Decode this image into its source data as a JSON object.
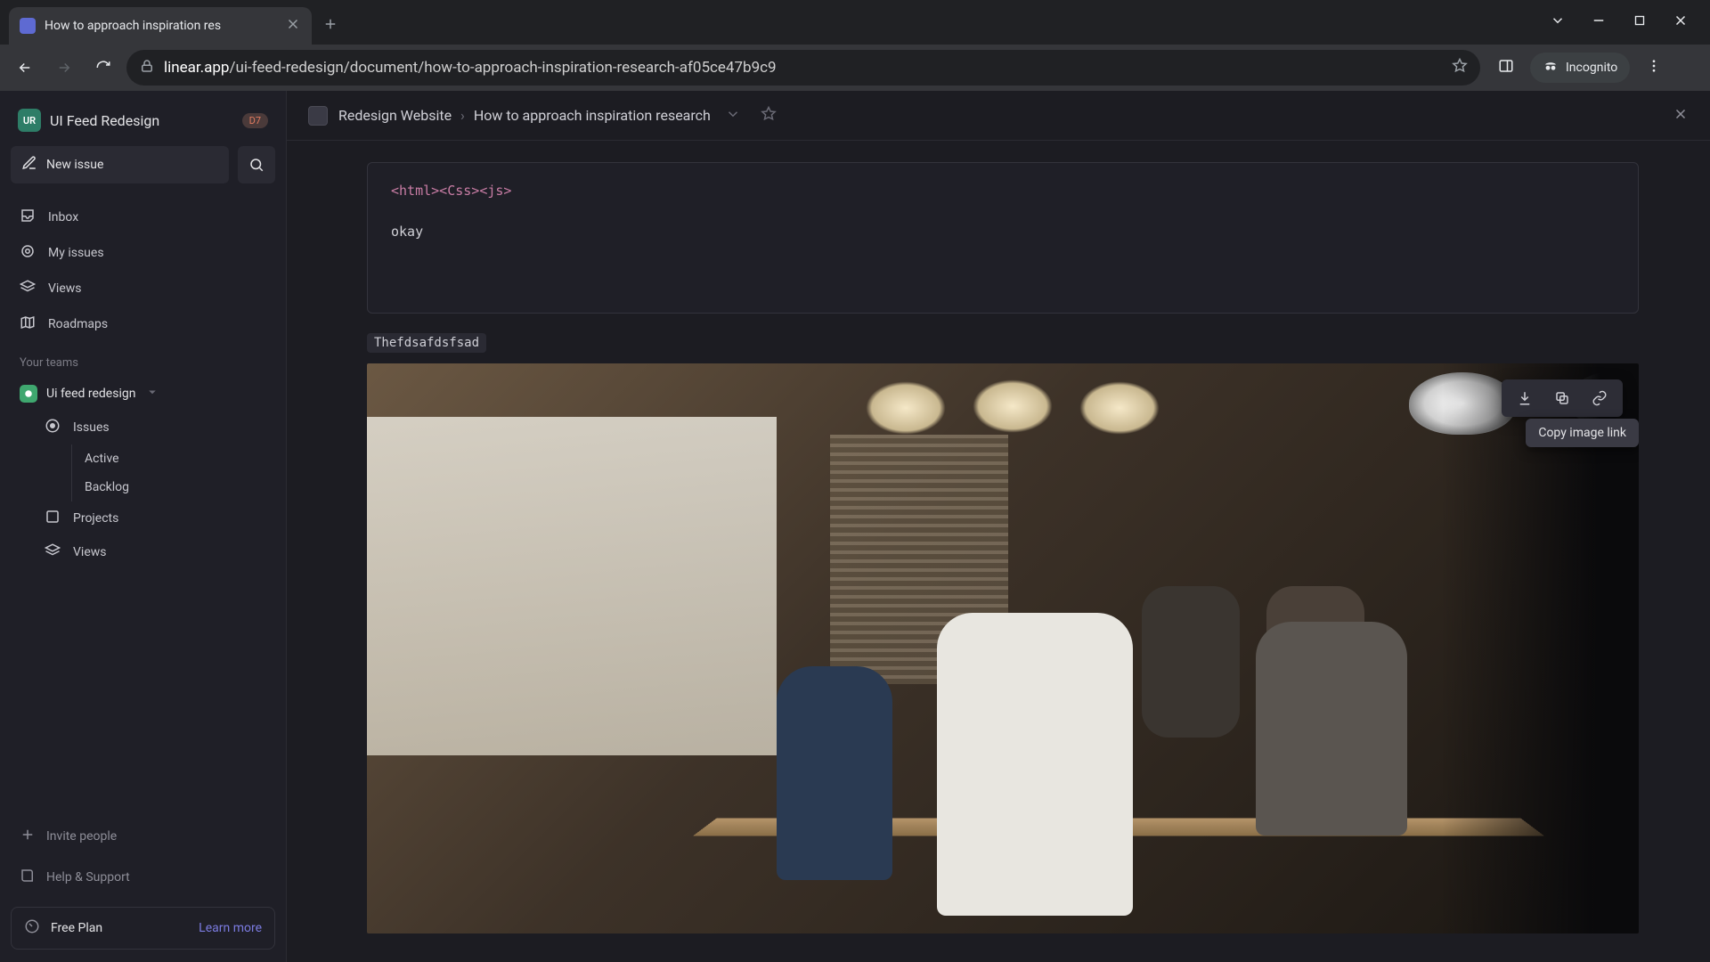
{
  "browser": {
    "tab_title": "How to approach inspiration res",
    "url_domain": "linear.app",
    "url_path": "/ui-feed-redesign/document/how-to-approach-inspiration-research-af05ce47b9c9",
    "incognito_label": "Incognito"
  },
  "workspace": {
    "avatar": "UR",
    "name": "UI Feed Redesign",
    "badge": "D7"
  },
  "sidebar": {
    "new_issue": "New issue",
    "nav": {
      "inbox": "Inbox",
      "my_issues": "My issues",
      "views": "Views",
      "roadmaps": "Roadmaps"
    },
    "teams_header": "Your teams",
    "team_name": "Ui feed redesign",
    "team_items": {
      "issues": "Issues",
      "active": "Active",
      "backlog": "Backlog",
      "projects": "Projects",
      "views": "Views"
    },
    "footer": {
      "invite": "Invite people",
      "help": "Help & Support",
      "plan": "Free Plan",
      "learn": "Learn more"
    }
  },
  "document": {
    "project": "Redesign Website",
    "title": "How to approach inspiration research",
    "code_line": "<html><Css><js>",
    "code_text": "okay",
    "inline_code": "Thefdsafdsfsad",
    "tooltip": "Copy image link"
  }
}
